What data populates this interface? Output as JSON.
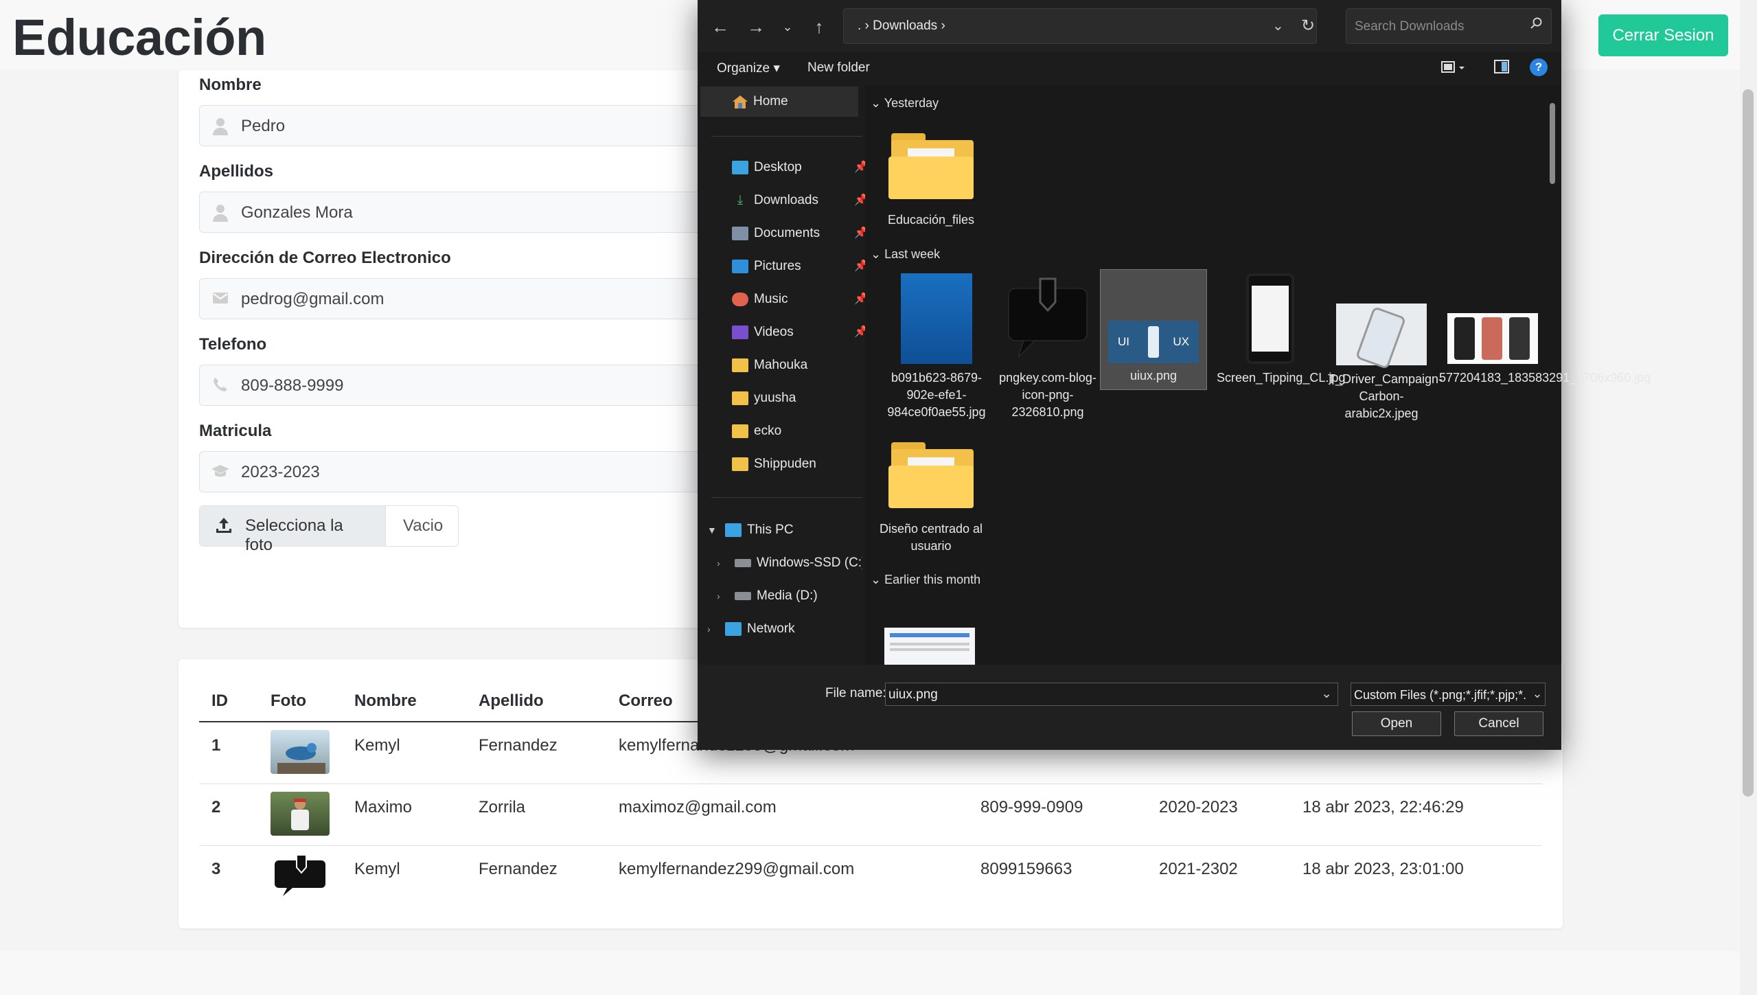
{
  "page": {
    "title": "Educación",
    "logout_label": "Cerrar Sesion"
  },
  "form": {
    "nombre_label": "Nombre",
    "nombre_value": "Pedro",
    "apellidos_label": "Apellidos",
    "apellidos_value": "Gonzales Mora",
    "email_label": "Dirección de Correo Electronico",
    "email_value": "pedrog@gmail.com",
    "telefono_label": "Telefono",
    "telefono_value": "809-888-9999",
    "matricula_label": "Matricula",
    "matricula_value": "2023-2023",
    "photo_button_label": "Selecciona la foto",
    "photo_status": "Vacio"
  },
  "table": {
    "headers": [
      "ID",
      "Foto",
      "Nombre",
      "Apellido",
      "Correo"
    ],
    "rows": [
      {
        "id": "1",
        "nombre": "Kemyl",
        "apellido": "Fernandez",
        "correo": "kemylfernandez299@gmail.com",
        "telefono": "",
        "matricula": "",
        "fecha": ""
      },
      {
        "id": "2",
        "nombre": "Maximo",
        "apellido": "Zorrila",
        "correo": "maximoz@gmail.com",
        "telefono": "809-999-0909",
        "matricula": "2020-2023",
        "fecha": "18 abr 2023, 22:46:29"
      },
      {
        "id": "3",
        "nombre": "Kemyl",
        "apellido": "Fernandez",
        "correo": "kemylfernandez299@gmail.com",
        "telefono": "8099159663",
        "matricula": "2021-2302",
        "fecha": "18 abr 2023, 23:01:00"
      }
    ]
  },
  "dialog": {
    "address_path": ". › Downloads ›",
    "search_placeholder": "Search Downloads",
    "organize_label": "Organize ▾",
    "new_folder_label": "New folder",
    "nav": {
      "home": "Home",
      "items": [
        "Desktop",
        "Downloads",
        "Documents",
        "Pictures",
        "Music",
        "Videos",
        "Mahouka",
        "yuusha",
        "ecko",
        "Shippuden"
      ],
      "this_pc": "This PC",
      "drives": [
        "Windows-SSD (C:)",
        "Media (D:)"
      ],
      "network": "Network"
    },
    "groups": {
      "yesterday": "Yesterday",
      "last_week": "Last week",
      "earlier": "Earlier this month"
    },
    "files": {
      "educacion_files": "Educación_files",
      "b091": "b091b623-8679-902e-efe1-984ce0f0ae55.jpg",
      "pngkey": "pngkey.com-blog-icon-png-2326810.png",
      "uiux": "uiux.png",
      "screen": "Screen_Tipping_CL.jpg",
      "tdriver": "T_Driver_Campaign-Carbon-arabic2x.jpeg",
      "num": "577204183_183583291_1706x960.jpg",
      "diseno": "Diseño centrado al usuario"
    },
    "thumb_text": {
      "ui": "UI",
      "ux": "UX"
    },
    "file_name_label": "File name:",
    "file_name_value": "uiux.png",
    "file_type_value": "Custom Files (*.png;*.jfif;*.pjp;*.",
    "open_label": "Open",
    "cancel_label": "Cancel"
  }
}
